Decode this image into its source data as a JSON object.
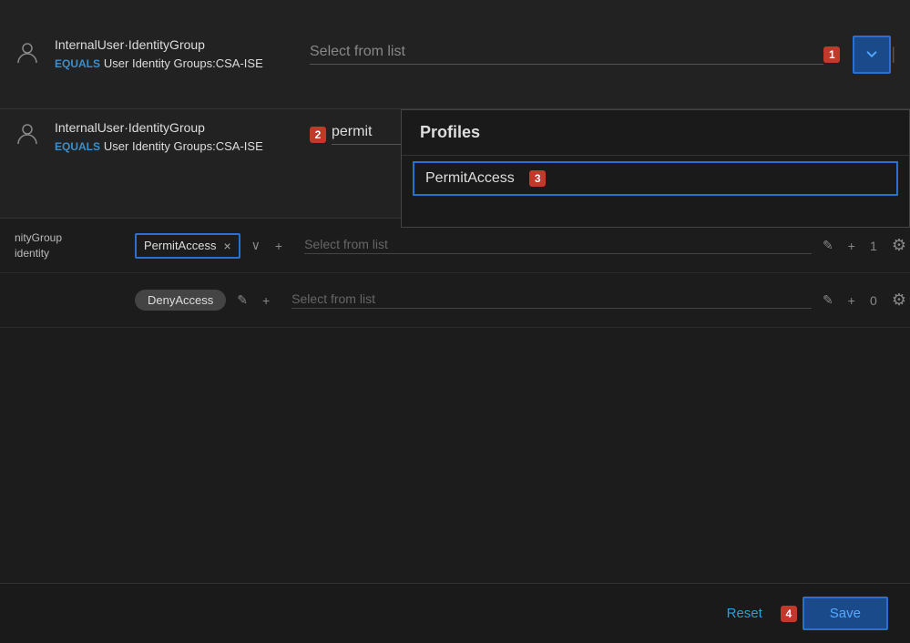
{
  "rows": [
    {
      "id": "row1",
      "identityGroup": "InternalUser·IdentityGroup",
      "equals": "EQUALS",
      "groups": "User Identity Groups:CSA-ISE",
      "step": "1",
      "selectLabel": "Select from list",
      "showDropdown": true
    },
    {
      "id": "row2",
      "identityGroup": "InternalUser·IdentityGroup",
      "equals": "EQUALS",
      "groups": "User Identity Groups:CSA-ISE",
      "step": "2",
      "searchValue": "permit",
      "dropdownHeader": "Profiles",
      "dropdownItems": [
        "PermitAccess"
      ],
      "selectedItem": "PermitAccess",
      "stepItem": "3"
    }
  ],
  "dataRows": [
    {
      "leftText1": "nityGroup",
      "leftText2": "identity",
      "profileTag": "PermitAccess",
      "selectLabel": "Select from list",
      "count": "1"
    },
    {
      "profileTag": "DenyAccess",
      "selectLabel": "Select from list",
      "count": "0"
    }
  ],
  "footer": {
    "resetLabel": "Reset",
    "saveLabel": "Save",
    "step": "4"
  },
  "icons": {
    "user": "👤",
    "chevronDown": "∨",
    "chevronUp": "∧",
    "plus": "+",
    "pencil": "✎",
    "gear": "⚙"
  }
}
